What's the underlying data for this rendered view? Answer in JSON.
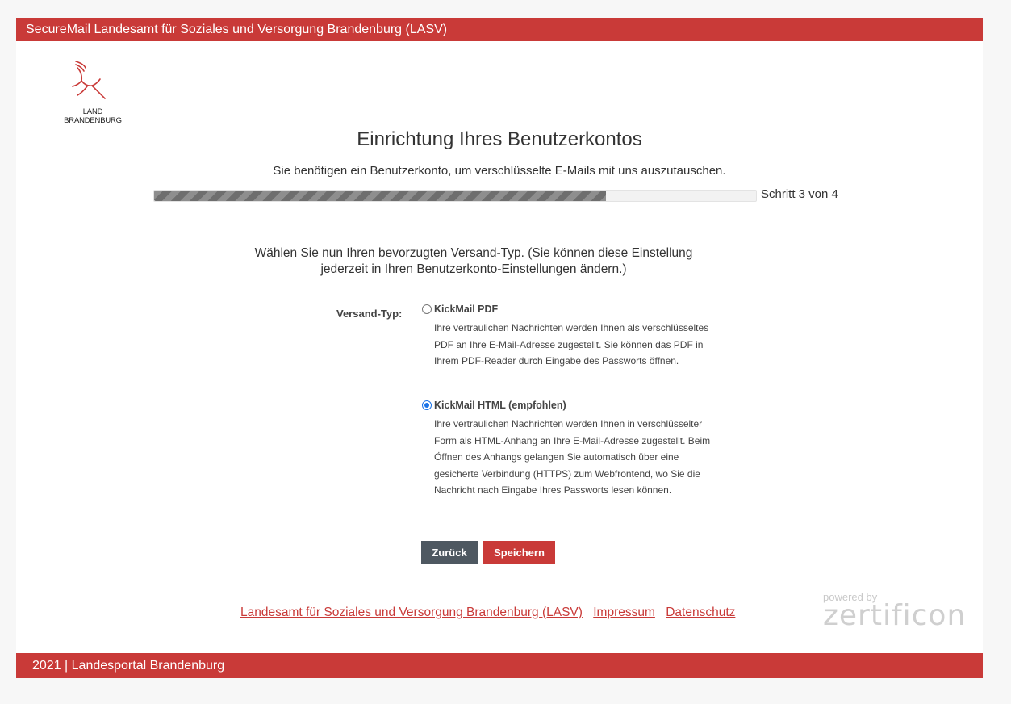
{
  "header": {
    "title": "SecureMail Landesamt für Soziales und Versorgung Brandenburg (LASV)"
  },
  "logo": {
    "line1": "LAND",
    "line2": "BRANDENBURG"
  },
  "page": {
    "title": "Einrichtung Ihres Benutzerkontos",
    "subtitle": "Sie benötigen ein Benutzerkonto, um verschlüsselte E-Mails mit uns auszutauschen."
  },
  "progress": {
    "step": 3,
    "total": 4,
    "fraction": 0.75,
    "label": "Schritt 3 von 4"
  },
  "form": {
    "intro": "Wählen Sie nun Ihren bevorzugten Versand-Typ. (Sie können diese Einstellung jederzeit in Ihren Benutzerkonto-Einstellungen ändern.)",
    "field_label": "Versand-Typ:",
    "options": [
      {
        "title": "KickMail PDF",
        "description": "Ihre vertraulichen Nachrichten werden Ihnen als verschlüsseltes PDF an Ihre E-Mail-Adresse zugestellt. Sie können das PDF in Ihrem PDF-Reader durch Eingabe des Passworts öffnen.",
        "selected": false
      },
      {
        "title": "KickMail HTML (empfohlen)",
        "description": "Ihre vertraulichen Nachrichten werden Ihnen in verschlüsselter Form als HTML-Anhang an Ihre E-Mail-Adresse zugestellt. Beim Öffnen des Anhangs gelangen Sie automatisch über eine gesicherte Verbindung (HTTPS) zum Webfrontend, wo Sie die Nachricht nach Eingabe Ihres Passworts lesen können.",
        "selected": true
      }
    ],
    "back_label": "Zurück",
    "save_label": "Speichern"
  },
  "footer": {
    "links": [
      "Landesamt für Soziales und Versorgung Brandenburg (LASV)",
      "Impressum",
      "Datenschutz"
    ],
    "powered_by": "powered by",
    "brand": "zertificon",
    "bottom_text": "2021 | Landesportal Brandenburg"
  },
  "colors": {
    "accent": "#c93a38",
    "back_button": "#4e5861",
    "progress": "#6e6e6e",
    "radio": "#1a73e8"
  }
}
